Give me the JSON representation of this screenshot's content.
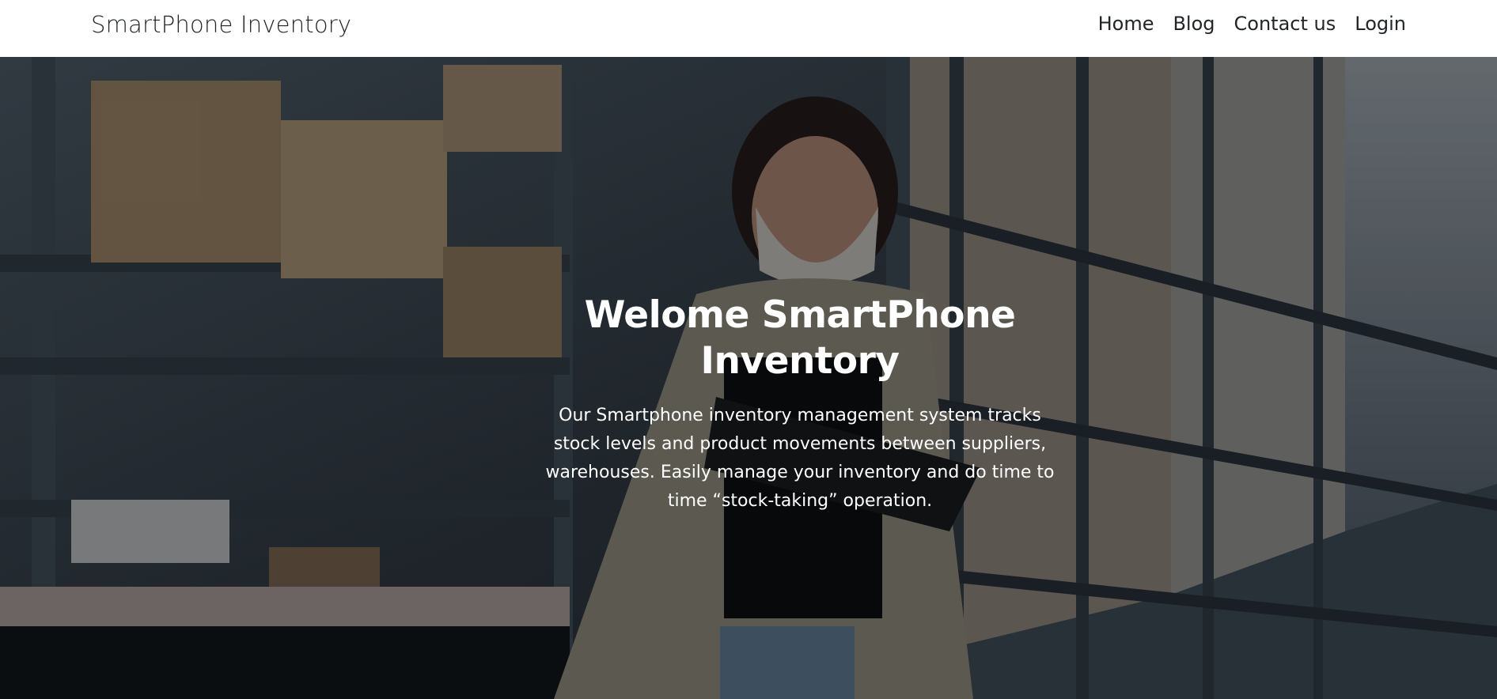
{
  "navbar": {
    "brand": "SmartPhone Inventory",
    "links": [
      "Home",
      "Blog",
      "Contact us",
      "Login"
    ]
  },
  "hero": {
    "title": "Welome SmartPhone Inventory",
    "description": "Our Smartphone inventory management system tracks stock levels and product movements between suppliers, warehouses. Easily manage your inventory and do time to time “stock-taking” operation.",
    "background_image": "warehouse-worker-photo"
  },
  "colors": {
    "navbar_bg": "#ffffff",
    "nav_text": "#212529",
    "hero_text": "#ffffff"
  }
}
